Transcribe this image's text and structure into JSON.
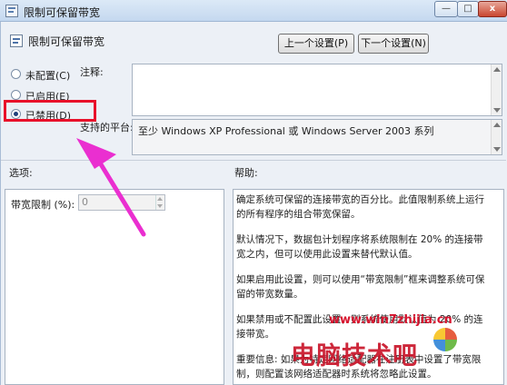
{
  "window": {
    "title": "限制可保留带宽",
    "controls": {
      "minimize": "—",
      "maximize": "□",
      "close": "x"
    }
  },
  "header": {
    "policy_title": "限制可保留带宽",
    "prev_button": "上一个设置(P)",
    "next_button": "下一个设置(N)"
  },
  "state": {
    "options": [
      {
        "label": "未配置(C)",
        "selected": false
      },
      {
        "label": "已启用(E)",
        "selected": false
      },
      {
        "label": "已禁用(D)",
        "selected": true
      }
    ]
  },
  "fields": {
    "note_label": "注释:",
    "note_value": "",
    "platform_label": "支持的平台:",
    "platform_value": "至少 Windows XP Professional 或 Windows Server 2003 系列"
  },
  "sections": {
    "options_label": "选项:",
    "help_label": "帮助:"
  },
  "options_pane": {
    "bandwidth_label": "带宽限制 (%):",
    "bandwidth_value": "0"
  },
  "help": {
    "paragraphs": [
      "确定系统可保留的连接带宽的百分比。此值限制系统上运行的所有程序的组合带宽保留。",
      "默认情况下，数据包计划程序将系统限制在 20% 的连接带宽之内，但可以使用此设置来替代默认值。",
      "如果启用此设置，则可以使用“带宽限制”框来调整系统可保留的带宽数量。",
      "如果禁用或不配置此设置，则系统使用默认值为 20% 的连接带宽。",
      "重要信息: 如果为特定网络适配器在注册表中设置了带宽限制，则配置该网络适配器时系统将忽略此设置。"
    ]
  },
  "watermark": {
    "url": "www.win7zhijia.cn",
    "brand": "电脑技术吧"
  },
  "colors": {
    "highlight": "#e8102a",
    "arrow": "#ea2fd0",
    "titlebar": "#c4d8ef",
    "watermark": "#c9152a"
  }
}
